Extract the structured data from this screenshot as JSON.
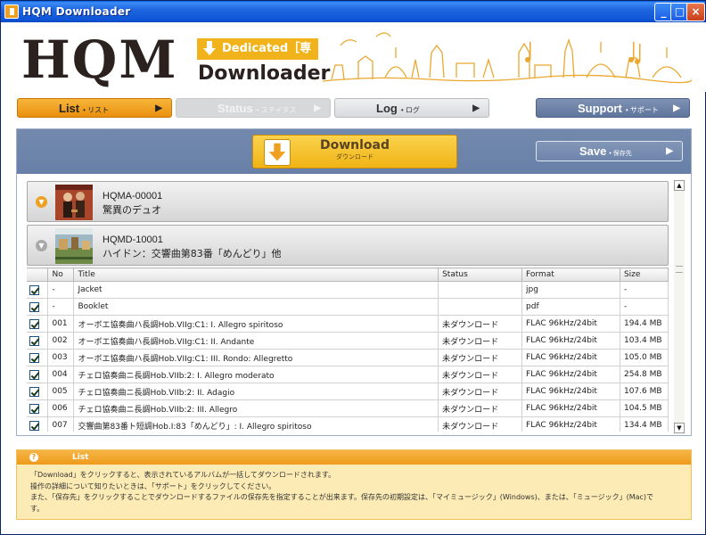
{
  "window": {
    "title": "HQM Downloader"
  },
  "header": {
    "logo": "HQM",
    "dedicated": "Dedicated［専用］",
    "downloader": "Downloader"
  },
  "nav": {
    "list": {
      "label": "List",
      "jp": "• リスト"
    },
    "status": {
      "label": "Status",
      "jp": "• ステイタス"
    },
    "log": {
      "label": "Log",
      "jp": "• ログ"
    },
    "support": {
      "label": "Support",
      "jp": "• サポート"
    }
  },
  "toolbar": {
    "download_label": "Download",
    "download_sub": "ダウンロード",
    "save_label": "Save",
    "save_jp": "• 保存先"
  },
  "albums": [
    {
      "code": "HQMA-00001",
      "name": "驚異のデュオ"
    },
    {
      "code": "HQMD-10001",
      "name": "ハイドン：交響曲第83番「めんどり」他"
    }
  ],
  "table": {
    "headers": [
      "No",
      "Title",
      "Status",
      "Format",
      "Size"
    ],
    "rows": [
      {
        "no": "-",
        "title": "Jacket",
        "status": "",
        "format": "jpg",
        "size": "-"
      },
      {
        "no": "-",
        "title": "Booklet",
        "status": "",
        "format": "pdf",
        "size": "-"
      },
      {
        "no": "001",
        "title": "オーボエ協奏曲ハ長調Hob.VIIg:C1: I. Allegro spiritoso",
        "status": "未ダウンロード",
        "format": "FLAC 96kHz/24bit",
        "size": "194.4 MB"
      },
      {
        "no": "002",
        "title": "オーボエ協奏曲ハ長調Hob.VIIg:C1: II. Andante",
        "status": "未ダウンロード",
        "format": "FLAC 96kHz/24bit",
        "size": "103.4 MB"
      },
      {
        "no": "003",
        "title": "オーボエ協奏曲ハ長調Hob.VIIg:C1: III. Rondo: Allegretto",
        "status": "未ダウンロード",
        "format": "FLAC 96kHz/24bit",
        "size": "105.0 MB"
      },
      {
        "no": "004",
        "title": "チェロ協奏曲ニ長調Hob.VIIb:2: I. Allegro moderato",
        "status": "未ダウンロード",
        "format": "FLAC 96kHz/24bit",
        "size": "254.8 MB"
      },
      {
        "no": "005",
        "title": "チェロ協奏曲ニ長調Hob.VIIb:2: II. Adagio",
        "status": "未ダウンロード",
        "format": "FLAC 96kHz/24bit",
        "size": "107.6 MB"
      },
      {
        "no": "006",
        "title": "チェロ協奏曲ニ長調Hob.VIIb:2: III. Allegro",
        "status": "未ダウンロード",
        "format": "FLAC 96kHz/24bit",
        "size": "104.5 MB"
      },
      {
        "no": "007",
        "title": "交響曲第83番ト短調Hob.I:83「めんどり」: I. Allegro spiritoso",
        "status": "未ダウンロード",
        "format": "FLAC 96kHz/24bit",
        "size": "134.4 MB"
      }
    ]
  },
  "help": {
    "title": "List",
    "lines": [
      "「Download」をクリックすると、表示されているアルバムが一括してダウンロードされます。",
      "操作の詳細について知りたいときは、「サポート」をクリックしてください。",
      "また、「保存先」をクリックすることでダウンロードするファイルの保存先を指定することが出来ます。保存先の初期設定は、「マイミュージック」(Windows)、または、「ミュージック」(Mac)で",
      "す。"
    ]
  },
  "colors": {
    "accent": "#ee9b1c",
    "panel": "#6f85ac",
    "title_bar": "#1f66e0"
  }
}
